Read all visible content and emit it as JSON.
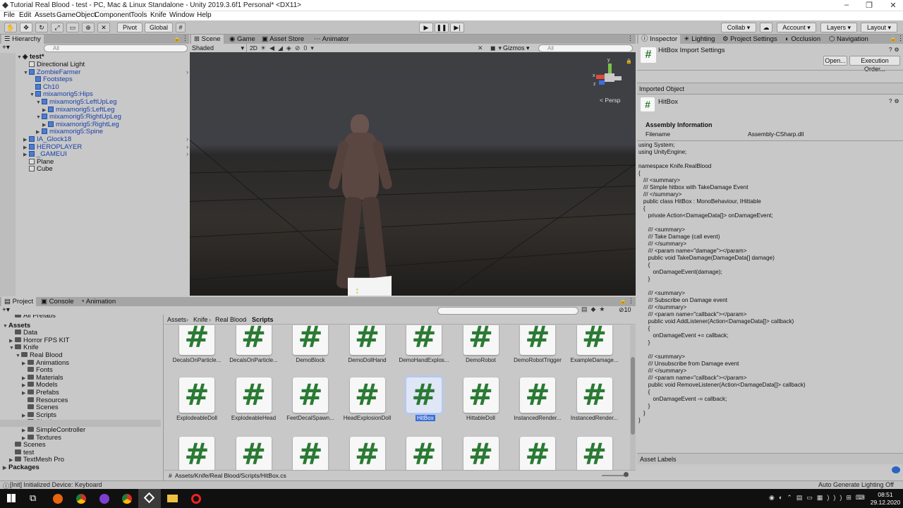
{
  "window": {
    "title": "Tutorial Real Blood - test - PC, Mac & Linux Standalone - Unity 2019.3.6f1 Personal* <DX11>",
    "minimize": "–",
    "maximize": "❐",
    "close": "✕"
  },
  "menu": [
    "File",
    "Edit",
    "Assets",
    "GameObject",
    "Component",
    "Tools",
    "Knife",
    "Window",
    "Help"
  ],
  "toolbar": {
    "pivot": "Pivot",
    "global": "Global",
    "collab": "Collab ▾",
    "account": "Account ▾",
    "layers": "Layers ▾",
    "layout": "Layout ▾"
  },
  "hierarchy": {
    "tab": "Hierarchy",
    "search_placeholder": "All",
    "scene": "test*",
    "items": [
      {
        "label": "Directional Light",
        "depth": 1,
        "blue": false,
        "arrow": ""
      },
      {
        "label": "ZombieFarmer",
        "depth": 1,
        "blue": true,
        "arrow": "▼"
      },
      {
        "label": "Footsteps",
        "depth": 2,
        "blue": true,
        "arrow": ""
      },
      {
        "label": "Ch10",
        "depth": 2,
        "blue": true,
        "arrow": ""
      },
      {
        "label": "mixamorig5:Hips",
        "depth": 2,
        "blue": true,
        "arrow": "▼"
      },
      {
        "label": "mixamorig5:LeftUpLeg",
        "depth": 3,
        "blue": true,
        "arrow": "▼"
      },
      {
        "label": "mixamorig5:LeftLeg",
        "depth": 4,
        "blue": true,
        "arrow": "▶"
      },
      {
        "label": "mixamorig5:RightUpLeg",
        "depth": 3,
        "blue": true,
        "arrow": "▼"
      },
      {
        "label": "mixamorig5:RightLeg",
        "depth": 4,
        "blue": true,
        "arrow": "▶"
      },
      {
        "label": "mixamorig5:Spine",
        "depth": 3,
        "blue": true,
        "arrow": "▶"
      },
      {
        "label": "IA_Glock18",
        "depth": 1,
        "blue": true,
        "arrow": "▶"
      },
      {
        "label": "HEROPLAYER",
        "depth": 1,
        "blue": true,
        "arrow": "▶"
      },
      {
        "label": "_GAMEUI",
        "depth": 1,
        "blue": true,
        "arrow": "▶"
      },
      {
        "label": "Plane",
        "depth": 1,
        "blue": false,
        "arrow": ""
      },
      {
        "label": "Cube",
        "depth": 1,
        "blue": false,
        "arrow": ""
      }
    ]
  },
  "scene": {
    "tabs": [
      "Scene",
      "Game",
      "Asset Store",
      "Animator"
    ],
    "shading": "Shaded",
    "mode_2d": "2D",
    "gizmos": "Gizmos",
    "search_placeholder": "All",
    "persp": "< Persp",
    "axis_y": "y",
    "axis_x": "x",
    "axis_z": "z"
  },
  "project": {
    "tabs": [
      "Project",
      "Console",
      "Animation"
    ],
    "hidden_count": "10",
    "breadcrumb": [
      "Assets",
      "Knife",
      "Real Blood",
      "Scripts"
    ],
    "tree": [
      {
        "label": "All Prefabs",
        "depth": 1,
        "bold": false,
        "arrow": ""
      },
      {
        "label": "Assets",
        "depth": 0,
        "bold": true,
        "arrow": "▼"
      },
      {
        "label": "Data",
        "depth": 1,
        "bold": false,
        "arrow": ""
      },
      {
        "label": "Horror FPS KIT",
        "depth": 1,
        "bold": false,
        "arrow": "▶"
      },
      {
        "label": "Knife",
        "depth": 1,
        "bold": false,
        "arrow": "▼"
      },
      {
        "label": "Real Blood",
        "depth": 2,
        "bold": false,
        "arrow": "▼"
      },
      {
        "label": "Animations",
        "depth": 3,
        "bold": false,
        "arrow": "▶"
      },
      {
        "label": "Fonts",
        "depth": 3,
        "bold": false,
        "arrow": ""
      },
      {
        "label": "Materials",
        "depth": 3,
        "bold": false,
        "arrow": "▶"
      },
      {
        "label": "Models",
        "depth": 3,
        "bold": false,
        "arrow": "▶"
      },
      {
        "label": "Prefabs",
        "depth": 3,
        "bold": false,
        "arrow": "▶"
      },
      {
        "label": "Resources",
        "depth": 3,
        "bold": false,
        "arrow": ""
      },
      {
        "label": "Scenes",
        "depth": 3,
        "bold": false,
        "arrow": ""
      },
      {
        "label": "Scripts",
        "depth": 3,
        "bold": false,
        "arrow": "▶"
      },
      {
        "label": "Shaders",
        "depth": 3,
        "bold": false,
        "arrow": ""
      },
      {
        "label": "SimpleController",
        "depth": 3,
        "bold": false,
        "arrow": "▶"
      },
      {
        "label": "Textures",
        "depth": 3,
        "bold": false,
        "arrow": "▶"
      },
      {
        "label": "Scenes",
        "depth": 1,
        "bold": false,
        "arrow": ""
      },
      {
        "label": "test",
        "depth": 1,
        "bold": false,
        "arrow": ""
      },
      {
        "label": "TextMesh Pro",
        "depth": 1,
        "bold": false,
        "arrow": "▶"
      },
      {
        "label": "Packages",
        "depth": 0,
        "bold": true,
        "arrow": "▶"
      }
    ],
    "assets_row1": [
      "DecalsOnParticle...",
      "DecalsOnParticle...",
      "DemoBlock",
      "DemoDollHand",
      "DemoHandExplos...",
      "DemoRobot",
      "DemoRobotTrigger",
      "ExampleDamage..."
    ],
    "assets_row2": [
      "ExplodeableDoll",
      "ExplodeableHead",
      "FeetDecalSpawn...",
      "HeadExplosionDoll",
      "HitBox",
      "HittableDoll",
      "InstancedRender...",
      "InstancedRender..."
    ],
    "assets_row3": [
      "",
      "",
      "",
      "",
      "",
      "",
      "",
      ""
    ],
    "selected": "HitBox",
    "path": "Assets/Knife/Real Blood/Scripts/HitBox.cs",
    "hash": "#"
  },
  "inspector": {
    "tabs": [
      "Inspector",
      "Lighting",
      "Project Settings",
      "Occlusion",
      "Navigation"
    ],
    "header": "HitBox Import Settings",
    "open_btn": "Open...",
    "exec_btn": "Execution Order...",
    "imported_object": "Imported Object",
    "object_name": "HitBox",
    "assembly_info": "Assembly Information",
    "filename_label": "Filename",
    "filename_value": "Assembly-CSharp.dll",
    "code": "using System;\nusing UnityEngine;\n\nnamespace Knife.RealBlood\n{\n   /// <summary>\n   /// Simple hitbox with TakeDamage Event\n   /// </summary>\n   public class HitBox : MonoBehaviour, IHittable\n   {\n      private Action<DamageData[]> onDamageEvent;\n\n      /// <summary>\n      /// Take Damage (call event)\n      /// </summary>\n      /// <param name=\"damage\"></param>\n      public void TakeDamage(DamageData[] damage)\n      {\n         onDamageEvent(damage);\n      }\n\n      /// <summary>\n      /// Subscribe on Damage event\n      /// </summary>\n      /// <param name=\"callback\"></param>\n      public void AddListener(Action<DamageData[]> callback)\n      {\n         onDamageEvent += callback;\n      }\n\n      /// <summary>\n      /// Unsubscribe from Damage event\n      /// </summary>\n      /// <param name=\"callback\"></param>\n      public void RemoveListener(Action<DamageData[]> callback)\n      {\n         onDamageEvent -= callback;\n      }\n   }\n}",
    "asset_labels": "Asset Labels"
  },
  "status": {
    "message": "[Init] Initialized Device: Keyboard",
    "lighting": "Auto Generate Lighting Off"
  },
  "taskbar": {
    "time": "08:51",
    "date": "29.12.2020"
  }
}
